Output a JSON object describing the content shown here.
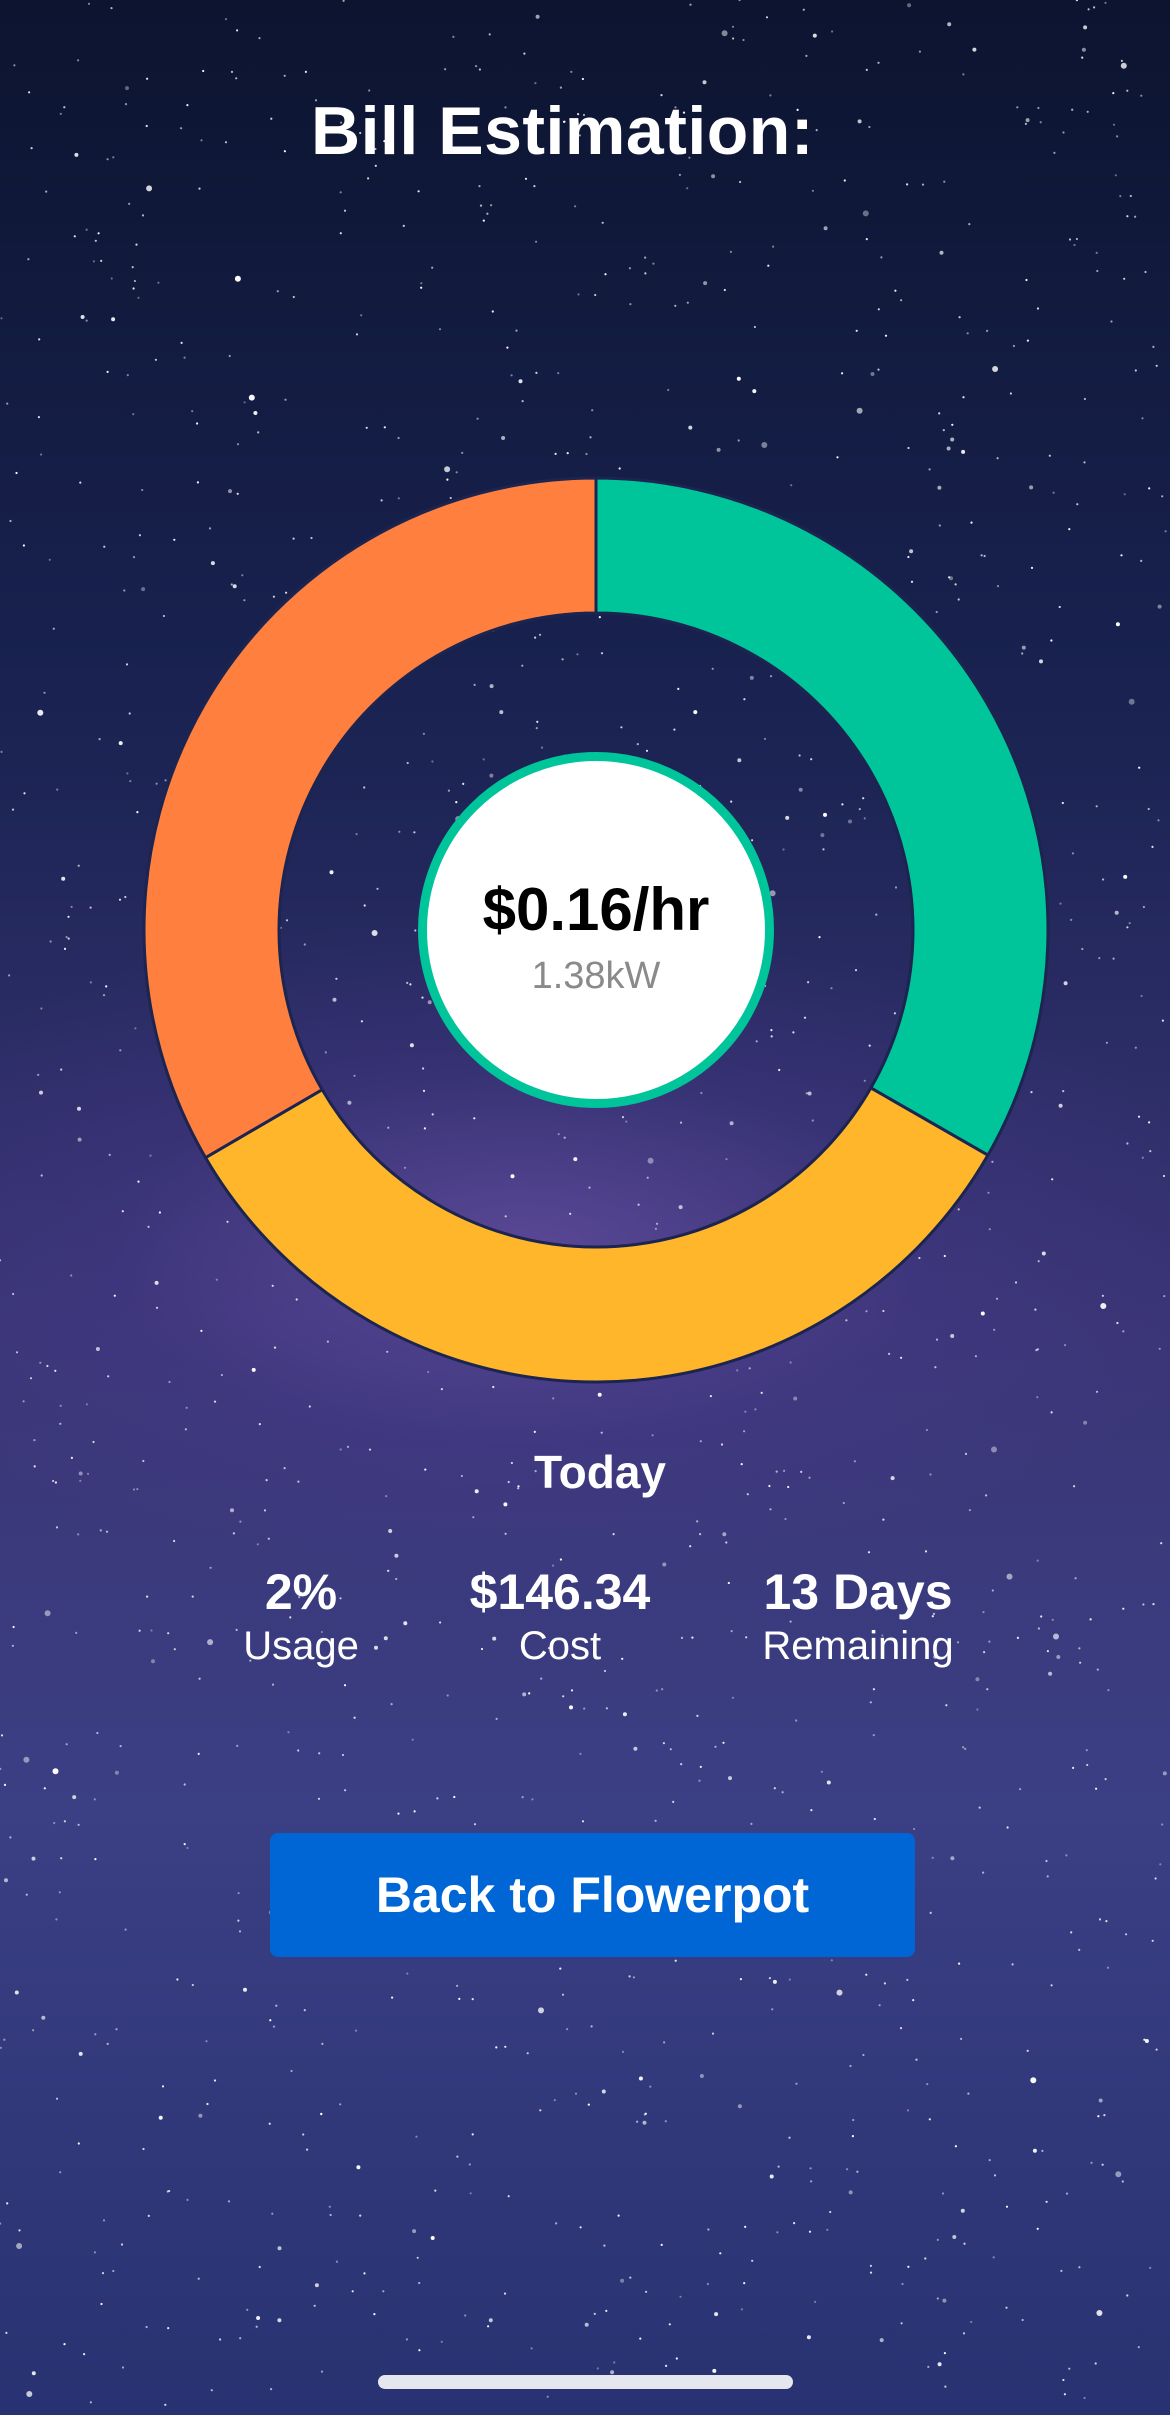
{
  "header": {
    "title": "Bill Estimation:"
  },
  "gauge": {
    "rate": "$0.16/hr",
    "power": "1.38kW"
  },
  "chart_data": {
    "type": "pie",
    "categories": [
      "",
      "",
      ""
    ],
    "values": [
      33.3,
      33.3,
      33.4
    ],
    "colors": [
      "#00c49a",
      "#ffb62a",
      "#ff7f3f"
    ]
  },
  "summary": {
    "period": "Today",
    "stats": [
      {
        "value": "2%",
        "label": "Usage"
      },
      {
        "value": "$146.34",
        "label": "Cost"
      },
      {
        "value": "13 Days",
        "label": "Remaining"
      }
    ]
  },
  "actions": {
    "back_label": "Back to Flowerpot"
  },
  "theme": {
    "background": "#1a2352",
    "accent_button": "#0066d6"
  }
}
